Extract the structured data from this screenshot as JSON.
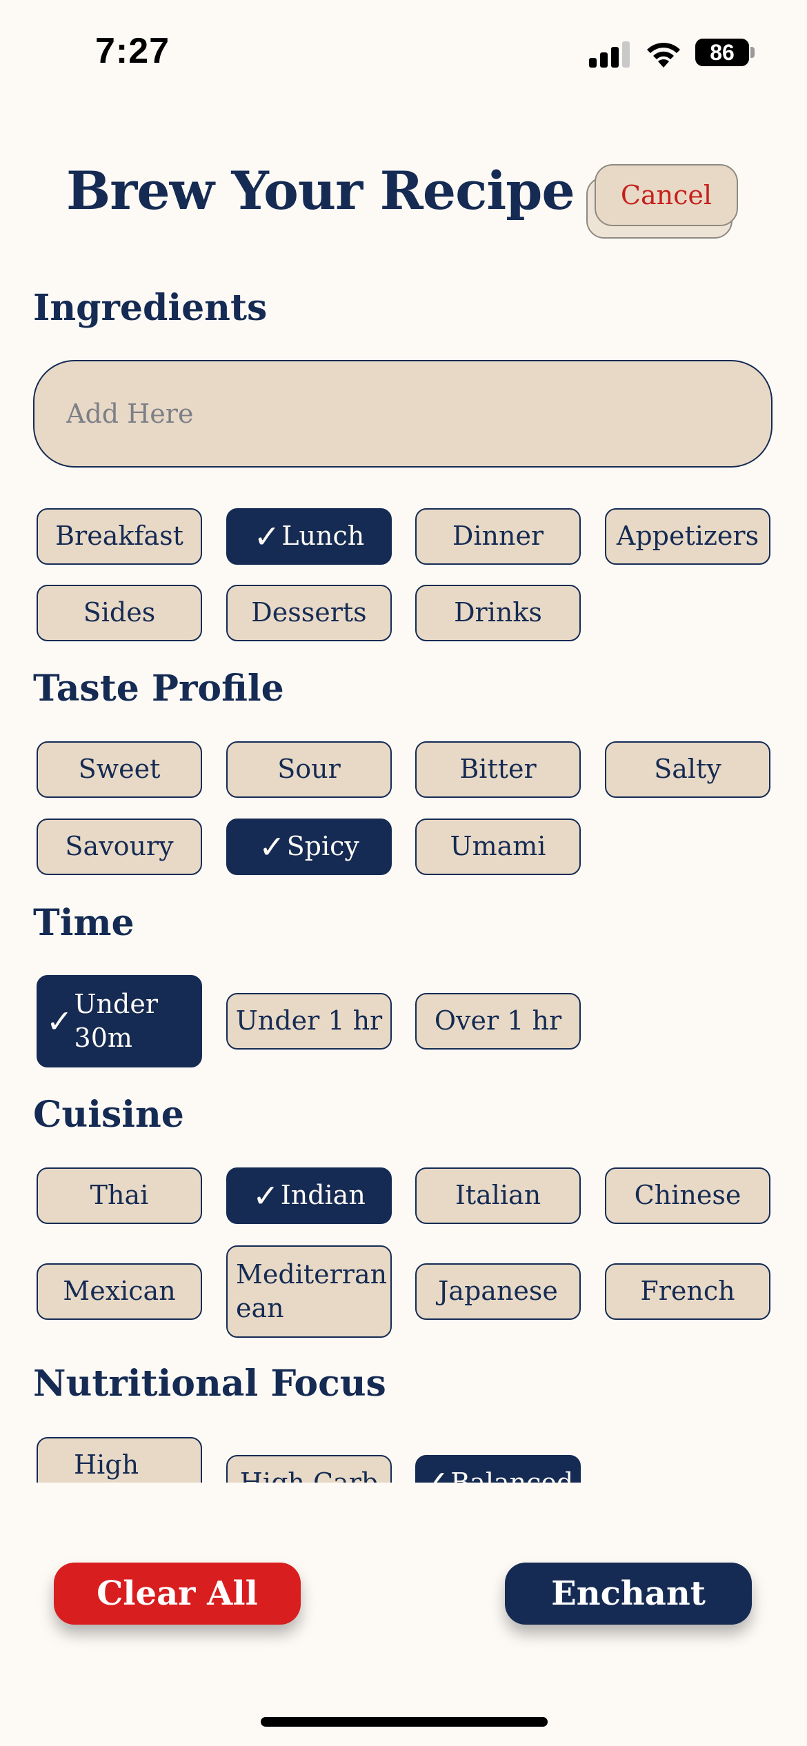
{
  "status_bar": {
    "time": "7:27",
    "battery": "86"
  },
  "header": {
    "title": "Brew Your Recipe",
    "cancel_label": "Cancel"
  },
  "ingredients": {
    "title": "Ingredients",
    "placeholder": "Add Here"
  },
  "meal_types": [
    {
      "label": "Breakfast",
      "selected": false
    },
    {
      "label": "Lunch",
      "selected": true
    },
    {
      "label": "Dinner",
      "selected": false
    },
    {
      "label": "Appetizers",
      "selected": false
    },
    {
      "label": "Sides",
      "selected": false
    },
    {
      "label": "Desserts",
      "selected": false
    },
    {
      "label": "Drinks",
      "selected": false
    }
  ],
  "taste_profile": {
    "title": "Taste Profile",
    "options": [
      {
        "label": "Sweet",
        "selected": false
      },
      {
        "label": "Sour",
        "selected": false
      },
      {
        "label": "Bitter",
        "selected": false
      },
      {
        "label": "Salty",
        "selected": false
      },
      {
        "label": "Savoury",
        "selected": false
      },
      {
        "label": "Spicy",
        "selected": true
      },
      {
        "label": "Umami",
        "selected": false
      }
    ]
  },
  "time": {
    "title": "Time",
    "options": [
      {
        "label_line1": "Under",
        "label_line2": "30m",
        "selected": true
      },
      {
        "label": "Under 1 hr",
        "selected": false
      },
      {
        "label": "Over 1 hr",
        "selected": false
      }
    ]
  },
  "cuisine": {
    "title": "Cuisine",
    "options": [
      {
        "label": "Thai",
        "selected": false
      },
      {
        "label": "Indian",
        "selected": true
      },
      {
        "label": "Italian",
        "selected": false
      },
      {
        "label": "Chinese",
        "selected": false
      },
      {
        "label": "Mexican",
        "selected": false
      },
      {
        "label_line1": "Mediterran",
        "label_line2": "ean",
        "selected": false
      },
      {
        "label": "Japanese",
        "selected": false
      },
      {
        "label": "French",
        "selected": false
      }
    ]
  },
  "nutritional_focus": {
    "title": "Nutritional Focus",
    "options": [
      {
        "label": "High",
        "selected": false
      },
      {
        "label": "High Carb",
        "selected": false
      },
      {
        "label": "Balanced",
        "selected": true
      }
    ]
  },
  "check_glyph": "✓",
  "footer": {
    "clear_label": "Clear All",
    "enchant_label": "Enchant"
  },
  "colors": {
    "navy": "#152B53",
    "tan": "#E8D9C6",
    "red": "#D81E1F",
    "background": "#FDFAF6"
  }
}
